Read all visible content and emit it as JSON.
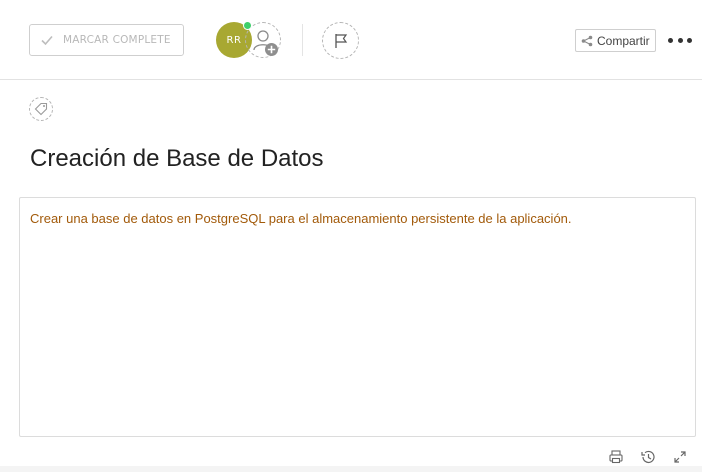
{
  "task": {
    "mark_complete_label": "MARCAR COMPLETE",
    "title": "Creación de Base de Datos",
    "description": "Crear una base de datos en PostgreSQL para el almacenamiento persistente de la aplicación."
  },
  "assignee": {
    "initials": "RR",
    "avatar_color": "#a8a832",
    "status_color": "#3ecf6a"
  },
  "toolbar": {
    "share_label": "Compartir"
  },
  "icons": {
    "check": "check-icon",
    "add_user": "add-user-icon",
    "flag": "flag-icon",
    "share": "share-icon",
    "more": "more-icon",
    "tag": "tag-icon",
    "print": "print-icon",
    "history": "history-icon",
    "expand": "expand-icon"
  },
  "colors": {
    "description_text": "#a25a0a"
  }
}
